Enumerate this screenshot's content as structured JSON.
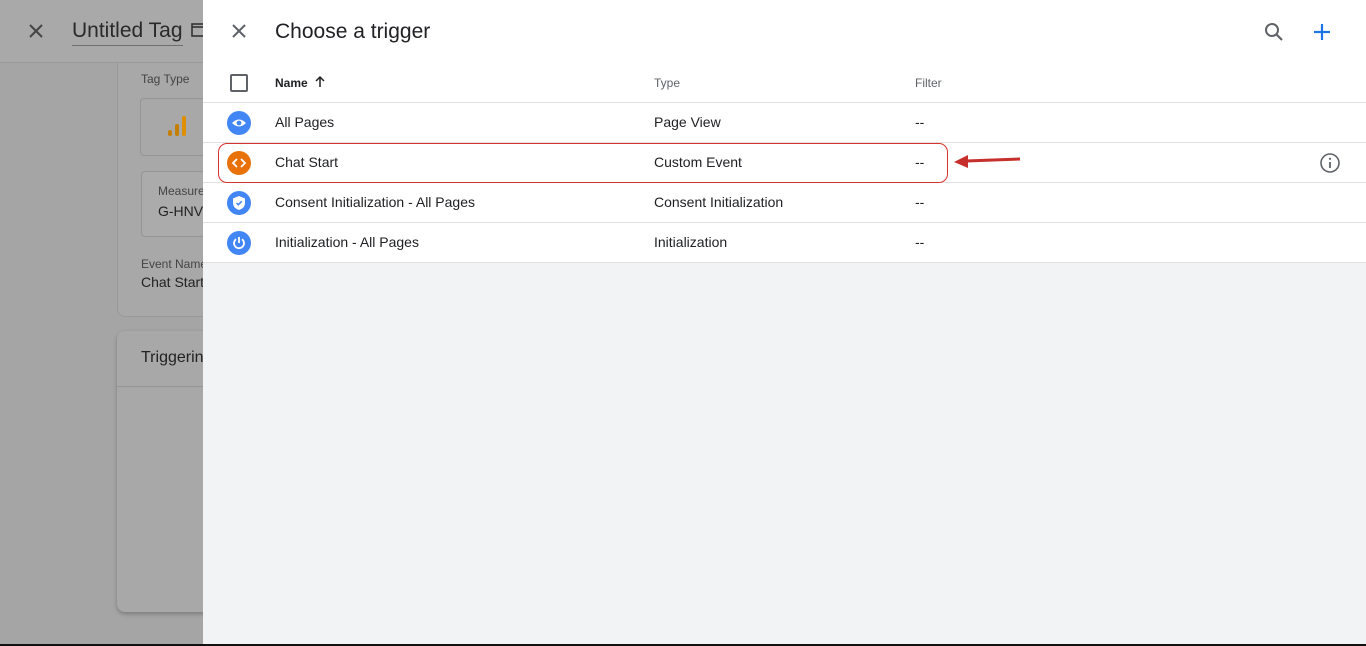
{
  "background": {
    "title": "Untitled Tag",
    "tag_type_label": "Tag Type",
    "measurement_label": "Measure",
    "measurement_value": "G-HNV",
    "event_name_label": "Event Name",
    "event_name_value": "Chat Start",
    "triggering_title": "Triggerin"
  },
  "panel": {
    "title": "Choose a trigger",
    "columns": {
      "name": "Name",
      "type": "Type",
      "filter": "Filter"
    },
    "rows": [
      {
        "name": "All Pages",
        "type": "Page View",
        "filter": "--",
        "icon": "eye-icon",
        "color": "#4285f4"
      },
      {
        "name": "Chat Start",
        "type": "Custom Event",
        "filter": "--",
        "icon": "code-icon",
        "color": "#e8710a"
      },
      {
        "name": "Consent Initialization - All Pages",
        "type": "Consent Initialization",
        "filter": "--",
        "icon": "shield-icon",
        "color": "#4285f4"
      },
      {
        "name": "Initialization - All Pages",
        "type": "Initialization",
        "filter": "--",
        "icon": "power-icon",
        "color": "#4285f4"
      }
    ]
  },
  "colors": {
    "accent": "#1a73e8",
    "highlight": "#d9332f",
    "ga_orange": "#f9ab00"
  }
}
